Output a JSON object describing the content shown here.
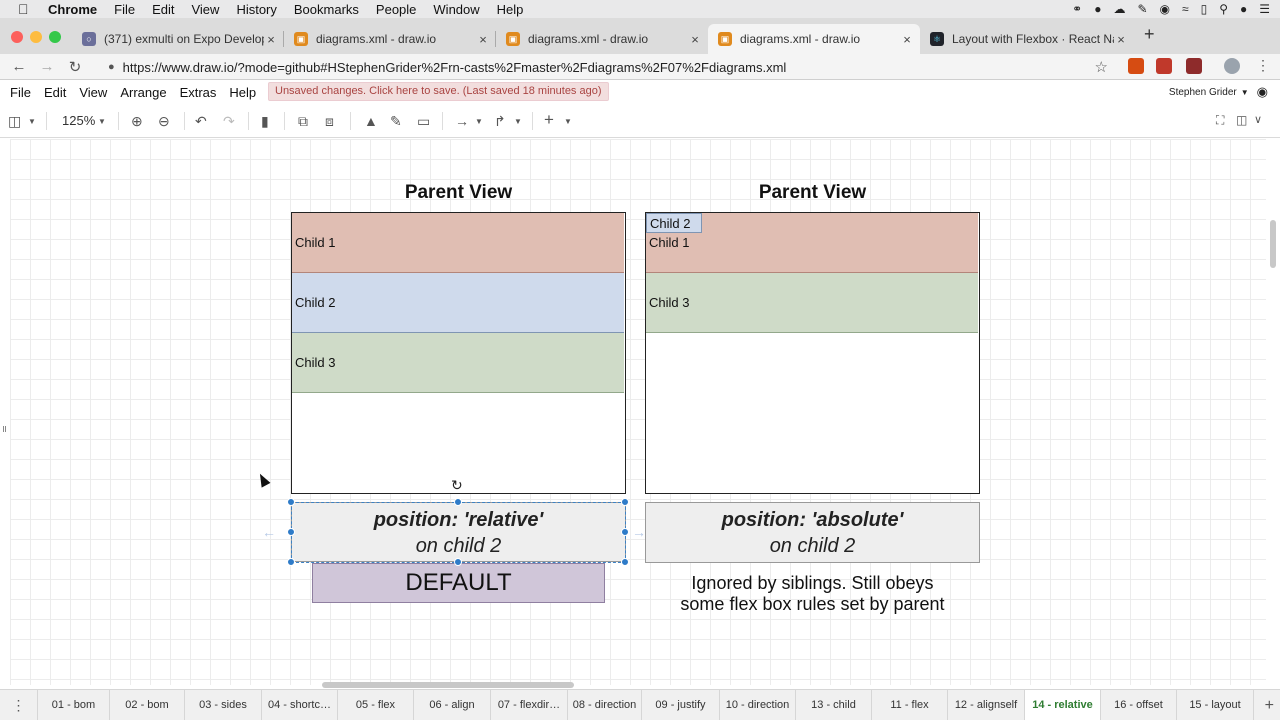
{
  "mac_menubar": {
    "app_name": "Chrome",
    "menus": [
      "File",
      "Edit",
      "View",
      "History",
      "Bookmarks",
      "People",
      "Window",
      "Help"
    ]
  },
  "tabs": [
    {
      "title": "(371) exmulti on Expo Developer",
      "favicon": "expo-icon",
      "active": false
    },
    {
      "title": "diagrams.xml - draw.io",
      "favicon": "drawio-icon",
      "active": false
    },
    {
      "title": "diagrams.xml - draw.io",
      "favicon": "drawio-icon",
      "active": false
    },
    {
      "title": "diagrams.xml - draw.io",
      "favicon": "drawio-icon",
      "active": true
    },
    {
      "title": "Layout with Flexbox · React Native",
      "favicon": "react-icon",
      "active": false
    }
  ],
  "address_bar": {
    "url": "https://www.draw.io/?mode=github#HStephenGrider%2Frn-casts%2Fmaster%2Fdiagrams%2F07%2Fdiagrams.xml"
  },
  "drawio_menu": {
    "items": [
      "File",
      "Edit",
      "View",
      "Arrange",
      "Extras",
      "Help"
    ],
    "unsaved_notice": "Unsaved changes. Click here to save. (Last saved 18 minutes ago)",
    "user_name": "Stephen Grider"
  },
  "toolbar": {
    "zoom": "125%"
  },
  "diagram": {
    "left": {
      "title": "Parent View",
      "children": [
        "Child 1",
        "Child 2",
        "Child 3"
      ],
      "note_line1": "position: 'relative'",
      "note_line2": "on child 2",
      "default_label": "DEFAULT"
    },
    "right": {
      "title": "Parent View",
      "children": [
        "Child 1",
        "Child 2",
        "Child 3"
      ],
      "note_line1": "position: 'absolute'",
      "note_line2": "on child 2",
      "caption_line1": "Ignored by siblings.  Still obeys",
      "caption_line2": "some flex box rules set by parent"
    },
    "colors": {
      "child1": "#e0beb3",
      "child2": "#cfdaec",
      "child3": "#cfdbc8",
      "default": "#d0c6d9",
      "selection": "#2e7bc8"
    }
  },
  "page_tabs": [
    {
      "label": "01 - bom",
      "active": false
    },
    {
      "label": "02 - bom",
      "active": false
    },
    {
      "label": "03 - sides",
      "active": false
    },
    {
      "label": "04 - shortc…",
      "active": false
    },
    {
      "label": "05 - flex",
      "active": false
    },
    {
      "label": "06 - align",
      "active": false
    },
    {
      "label": "07 - flexdir…",
      "active": false
    },
    {
      "label": "08 - direction",
      "active": false
    },
    {
      "label": "09 - justify",
      "active": false
    },
    {
      "label": "10 - direction",
      "active": false
    },
    {
      "label": "13 - child",
      "active": false
    },
    {
      "label": "11 - flex",
      "active": false
    },
    {
      "label": "12 - alignself",
      "active": false
    },
    {
      "label": "14 - relative",
      "active": true
    },
    {
      "label": "16 - offset",
      "active": false
    },
    {
      "label": "15 - layout",
      "active": false
    }
  ]
}
